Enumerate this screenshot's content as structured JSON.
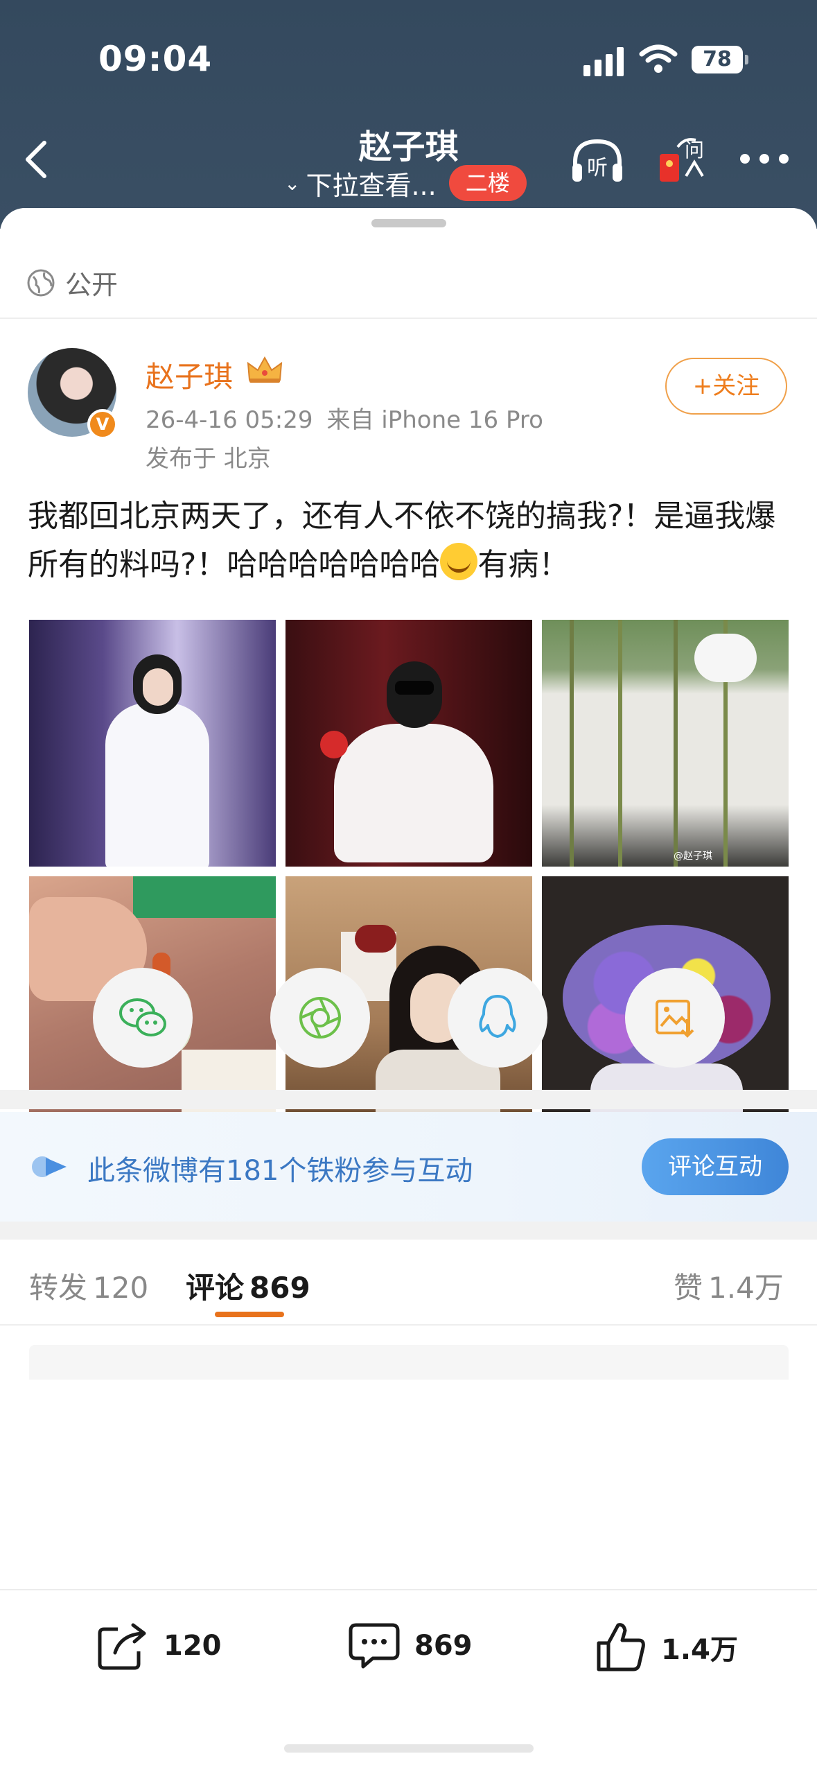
{
  "status_bar": {
    "time": "09:04",
    "battery": "78"
  },
  "nav": {
    "title": "赵子琪",
    "subtitle": "下拉查看...",
    "floor_badge": "二楼",
    "listen_label": "听",
    "ask_label": "问"
  },
  "post": {
    "visibility": "公开",
    "author": "赵子琪",
    "verified_mark": "V",
    "time": "26-4-16 05:29",
    "source": "来自 iPhone 16 Pro",
    "location": "发布于 北京",
    "follow_label": "+关注",
    "text_part1": "我都回北京两天了，还有人不依不饶的搞我?！是逼我爆所有的料吗?！哈哈哈哈哈哈哈",
    "text_part2": "有病！",
    "photos": [
      "stage-white-dress",
      "stage-sunglasses",
      "bamboo-courtyard",
      "jade-pendant",
      "portrait-room",
      "flower-bouquet"
    ],
    "photo_watermark": "@赵子琪"
  },
  "share": {
    "items": [
      "wechat-icon",
      "moments-icon",
      "qq-icon",
      "save-image-icon"
    ]
  },
  "fans": {
    "text": "此条微博有181个铁粉参与互动",
    "button": "评论互动"
  },
  "tabs": {
    "repost_label": "转发",
    "repost_count": "120",
    "comment_label": "评论",
    "comment_count": "869",
    "like_label": "赞",
    "like_count": "1.4万"
  },
  "actions": {
    "repost": "120",
    "comment": "869",
    "like": "1.4万"
  },
  "colors": {
    "header_bg": "#34495e",
    "accent_orange": "#e8721c",
    "link_blue": "#3b78c3",
    "badge_red": "#f04a3e"
  }
}
